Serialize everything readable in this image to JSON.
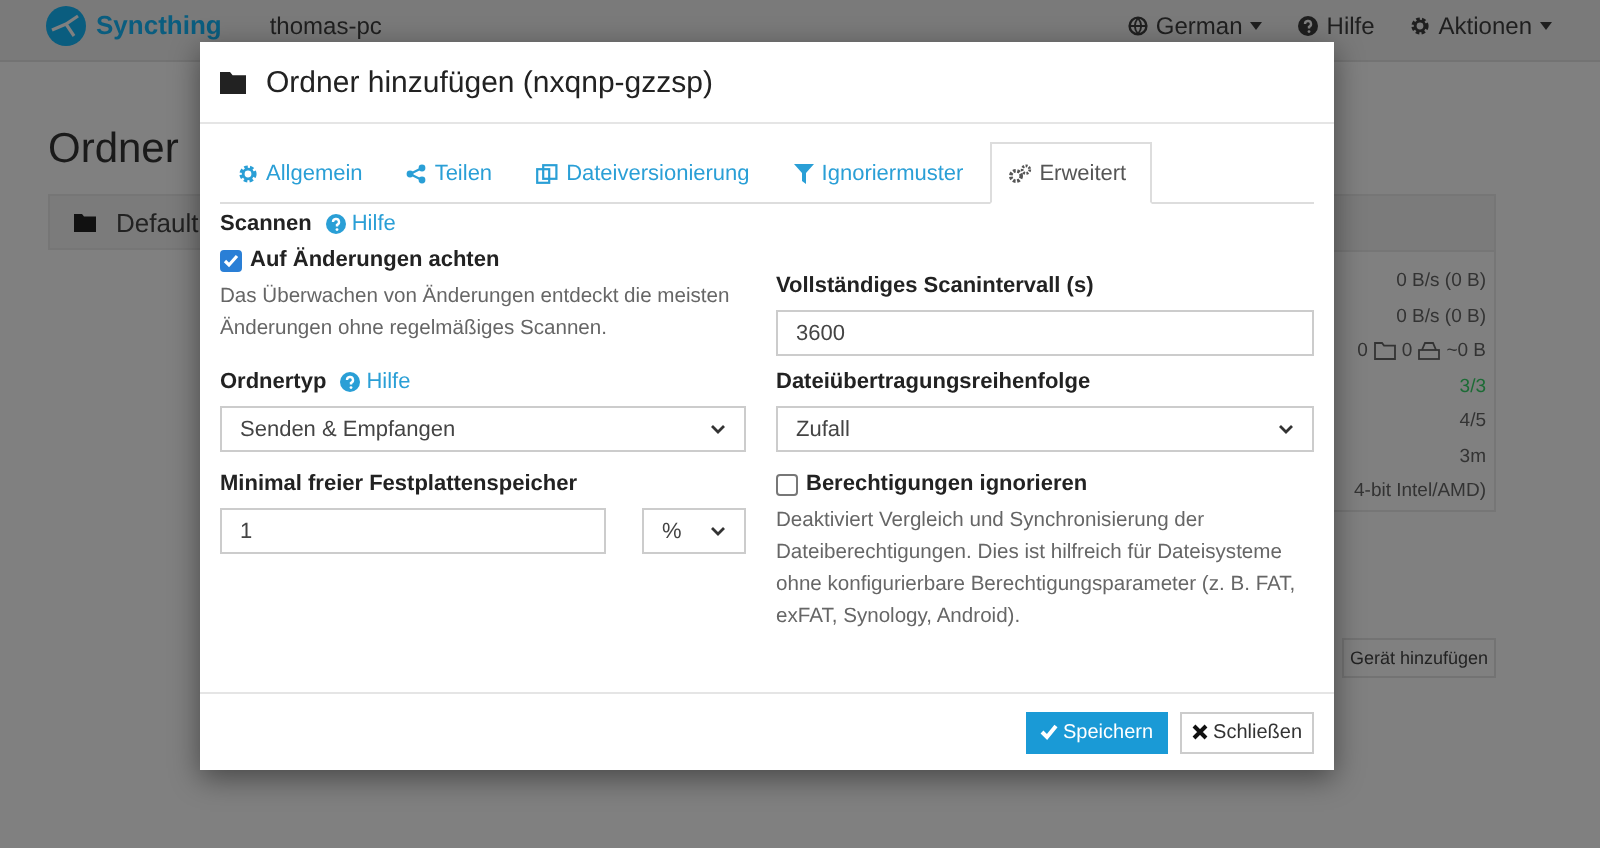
{
  "navbar": {
    "brand": "Syncthing",
    "device": "thomas-pc",
    "menus": [
      {
        "label": "German",
        "dropdown": true
      },
      {
        "label": "Hilfe",
        "dropdown": false
      },
      {
        "label": "Aktionen",
        "dropdown": true
      }
    ]
  },
  "page": {
    "heading": "Ordner",
    "folder": "Default",
    "status_rows": [
      {
        "kind": "text",
        "text": "0 B/s (0 B)",
        "color": "#333333"
      },
      {
        "kind": "text",
        "text": "0 B/s (0 B)",
        "color": "#333333"
      },
      {
        "kind": "counts",
        "parts": [
          "0",
          "0",
          "~0 B"
        ],
        "color": "#333333"
      },
      {
        "kind": "text",
        "text": "3/3",
        "color": "#1c6b35"
      },
      {
        "kind": "text",
        "text": "4/5",
        "color": "#333333"
      },
      {
        "kind": "text",
        "text": "3m",
        "color": "#333333"
      },
      {
        "kind": "text",
        "text": "4-bit Intel/AMD)",
        "color": "#333333"
      }
    ],
    "add_device_button": "Gerät hinzufügen"
  },
  "modal": {
    "title": "Ordner hinzufügen (nxqnp-gzzsp)",
    "tabs": [
      {
        "label": "Allgemein",
        "selected": false
      },
      {
        "label": "Teilen",
        "selected": false
      },
      {
        "label": "Dateiversionierung",
        "selected": false
      },
      {
        "label": "Ignoriermuster",
        "selected": false
      },
      {
        "label": "Erweitert",
        "selected": true
      }
    ],
    "scan": {
      "label": "Scannen",
      "help": "Hilfe",
      "watch": {
        "label": "Auf Änderungen achten",
        "checked": true
      },
      "watch_hint": "Das Überwachen von Änderungen entdeckt die meisten Änderungen ohne regelmäßiges Scannen.",
      "interval_label": "Vollständiges Scanintervall (s)",
      "interval_value": "3600"
    },
    "folder_type": {
      "label": "Ordnertyp",
      "help": "Hilfe",
      "value": "Senden & Empfangen"
    },
    "pull_order": {
      "label": "Dateiübertragungsreihenfolge",
      "value": "Zufall"
    },
    "min_disk": {
      "label": "Minimal freier Festplattenspeicher",
      "value": "1",
      "unit": "%"
    },
    "ignore_perms": {
      "label": "Berechtigungen ignorieren",
      "checked": false,
      "hint": "Deaktiviert Vergleich und Synchronisierung der Dateiberechtigungen. Dies ist hilfreich für Dateisysteme ohne konfigurierbare Berechtigungsparameter (z. B. FAT, exFAT, Synology, Android)."
    },
    "buttons": [
      {
        "label": "Speichern",
        "kind": "primary"
      },
      {
        "label": "Schließen",
        "kind": "default"
      }
    ]
  }
}
